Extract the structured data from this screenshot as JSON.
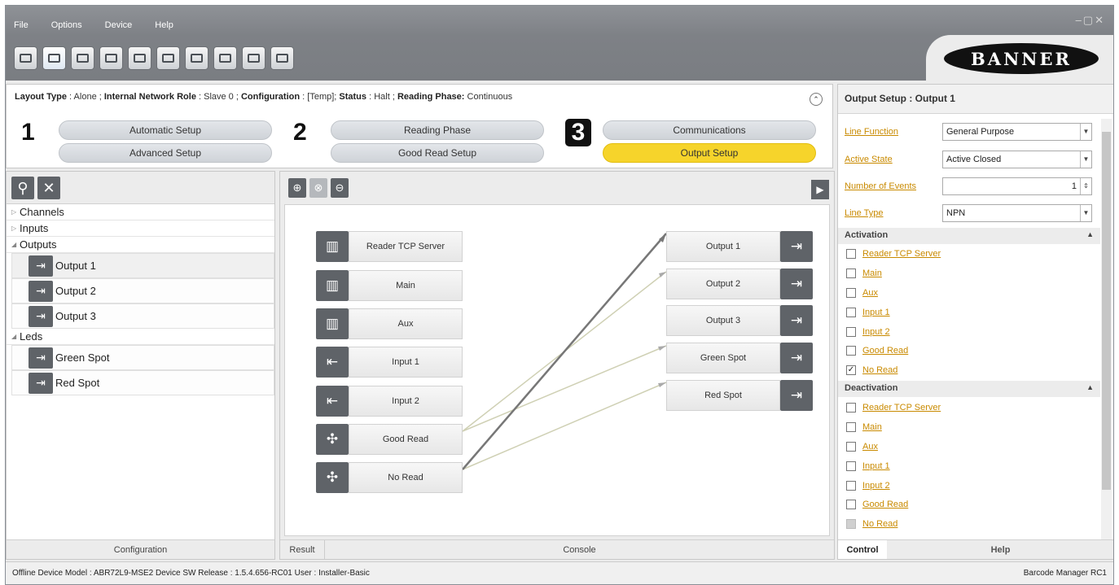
{
  "menu": [
    "File",
    "Options",
    "Device",
    "Help"
  ],
  "logo": "BANNER",
  "workflow": {
    "layout_label": "Layout Type",
    "layout_value": "Alone",
    "role_label": "Internal Network Role",
    "role_value": "Slave 0",
    "config_label": "Configuration",
    "config_value": "[Temp]",
    "status_label": "Status",
    "status_value": "Halt",
    "phase_label": "Reading Phase:",
    "phase_value": "Continuous",
    "steps": [
      {
        "num": "1",
        "top": "Automatic Setup",
        "bottom": "Advanced Setup"
      },
      {
        "num": "2",
        "top": "Reading Phase",
        "bottom": "Good Read Setup"
      },
      {
        "num": "3",
        "top": "Communications",
        "bottom": "Output Setup"
      }
    ]
  },
  "tree": {
    "channels": "Channels",
    "inputs": "Inputs",
    "outputs": "Outputs",
    "leds": "Leds",
    "output_items": [
      "Output 1",
      "Output 2",
      "Output 3"
    ],
    "led_items": [
      "Green Spot",
      "Red Spot"
    ],
    "footer": "Configuration"
  },
  "canvas": {
    "sources": [
      "Reader TCP Server",
      "Main",
      "Aux",
      "Input 1",
      "Input 2",
      "Good Read",
      "No Read"
    ],
    "targets": [
      "Output 1",
      "Output 2",
      "Output 3",
      "Green Spot",
      "Red Spot"
    ],
    "tab_result": "Result",
    "tab_console": "Console"
  },
  "props": {
    "title": "Output Setup : Output 1",
    "line_function_label": "Line Function",
    "line_function_value": "General Purpose",
    "active_state_label": "Active State",
    "active_state_value": "Active Closed",
    "events_label": "Number of Events",
    "events_value": "1",
    "line_type_label": "Line Type",
    "line_type_value": "NPN",
    "activation_header": "Activation",
    "activation_items": [
      "Reader TCP Server",
      "Main",
      "Aux",
      "Input 1",
      "Input 2",
      "Good Read",
      "No Read"
    ],
    "deactivation_header": "Deactivation",
    "deactivation_items": [
      "Reader TCP Server",
      "Main",
      "Aux",
      "Input 1",
      "Input 2",
      "Good Read",
      "No Read"
    ],
    "tab_control": "Control",
    "tab_help": "Help"
  },
  "statusbar": {
    "left": "Offline Device Model : ABR72L9-MSE2   Device SW Release : 1.5.4.656-RC01   User : Installer-Basic",
    "right": "Barcode Manager RC1"
  },
  "colors": {
    "accent": "#f6d42b",
    "link": "#c98a00",
    "icon": "#5f6368"
  }
}
